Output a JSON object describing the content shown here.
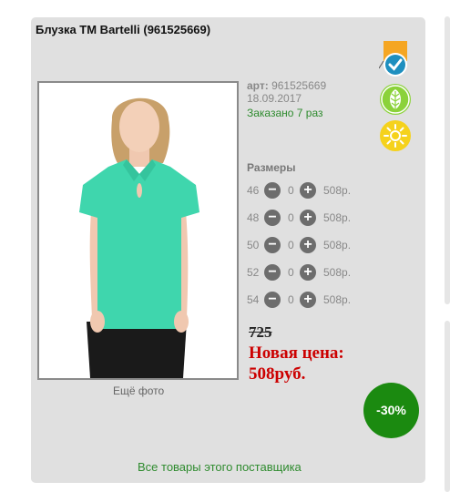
{
  "product": {
    "title": "Блузка ТМ Bartelli (961525669)",
    "art_label": "арт:",
    "art_value": "961525669",
    "date": "18.09.2017",
    "ordered": "Заказано 7 раз",
    "more_photo": "Ещё фото"
  },
  "sizes": {
    "title": "Размеры",
    "rows": [
      {
        "size": "46",
        "qty": "0",
        "price": "508р."
      },
      {
        "size": "48",
        "qty": "0",
        "price": "508р."
      },
      {
        "size": "50",
        "qty": "0",
        "price": "508р."
      },
      {
        "size": "52",
        "qty": "0",
        "price": "508р."
      },
      {
        "size": "54",
        "qty": "0",
        "price": "508р."
      }
    ]
  },
  "pricing": {
    "old_price": "725",
    "new_price_label": "Новая цена:",
    "new_price_value": "508руб.",
    "discount": "-30%"
  },
  "supplier_link": "Все товары этого поставщика",
  "icons": [
    "check-badge-icon",
    "leaf-icon",
    "sun-icon",
    "plus-icon",
    "minus-icon"
  ],
  "colors": {
    "accent_green": "#2e8b2e",
    "discount_bg": "#1b8a10",
    "price_red": "#cc0000",
    "leaf_green": "#8bd23a",
    "sun_yellow": "#f5d21c",
    "blouse": "#3fd6ad"
  }
}
